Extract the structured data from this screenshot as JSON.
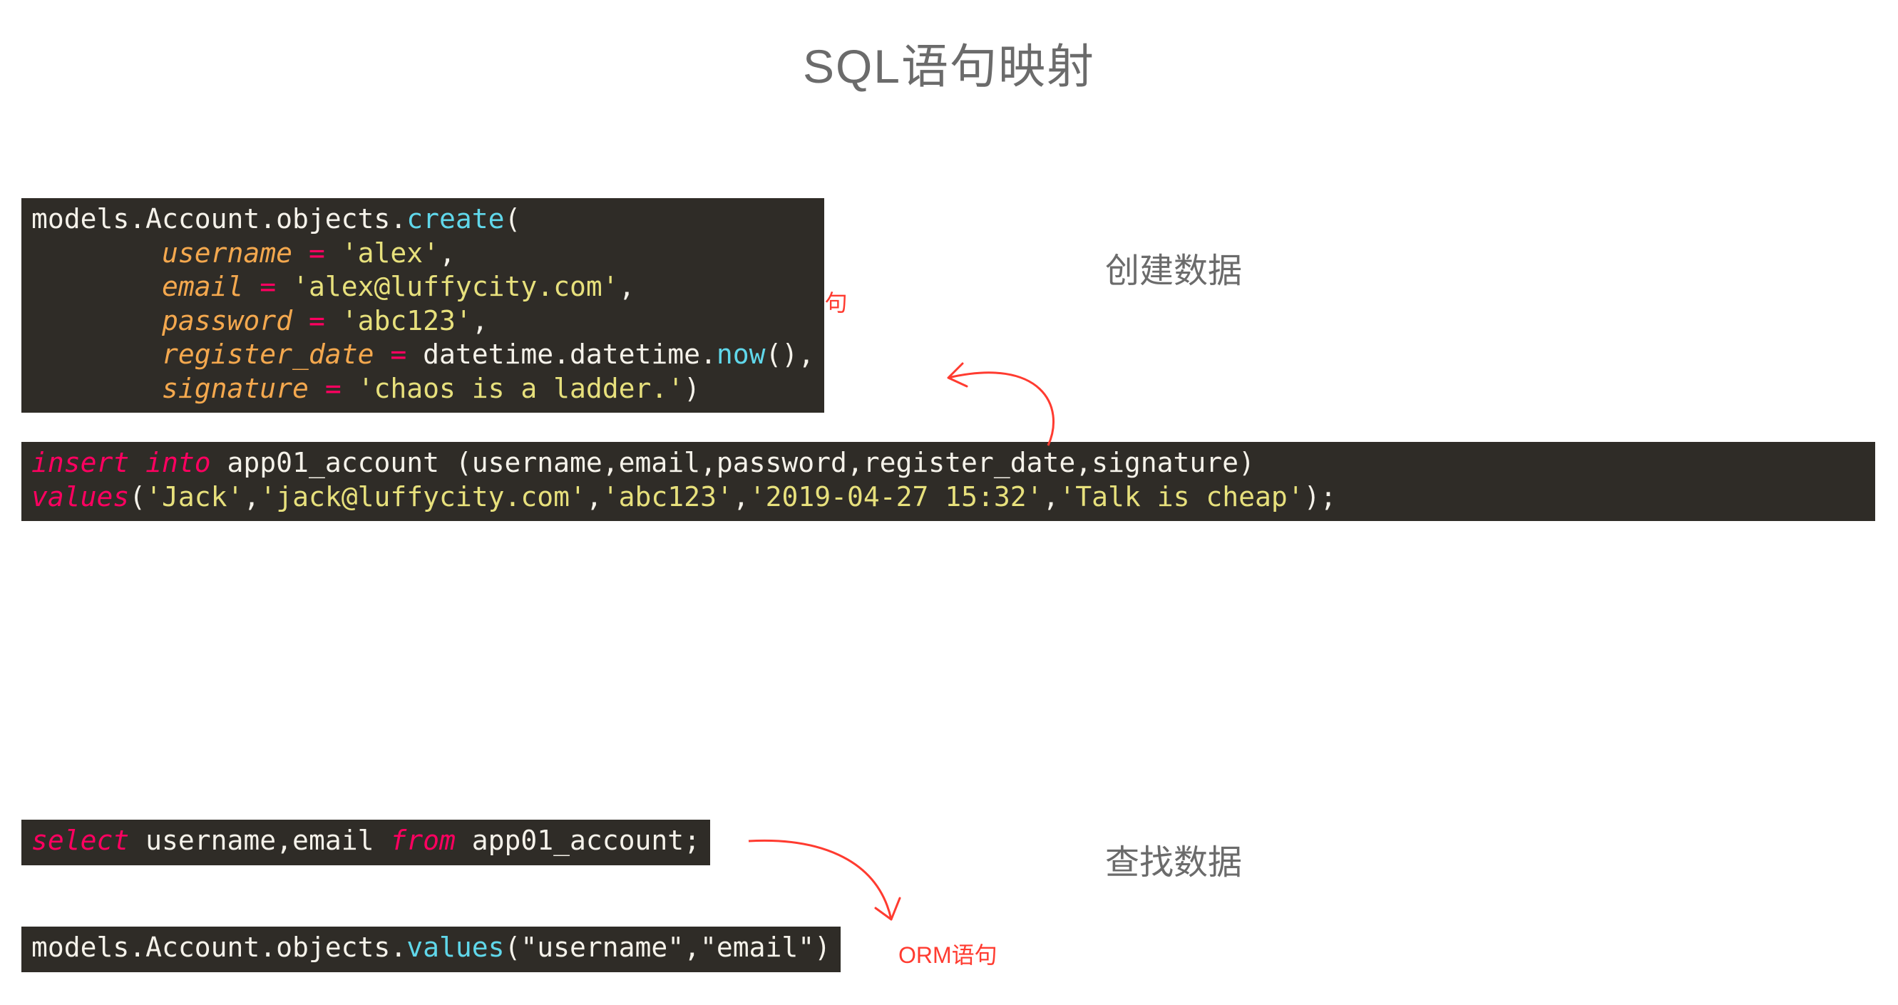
{
  "title": "SQL语句映射",
  "section1_label": "创建数据",
  "section2_label": "查找数据",
  "orm_label_1": "ORM语句",
  "orm_label_2": "ORM语句",
  "code": {
    "orm_create": {
      "prefix": "models.Account.objects.",
      "method": "create",
      "open": "(",
      "lines": [
        {
          "indent": "        ",
          "key": "username",
          "eq": " = ",
          "val": "'alex'",
          "trail": ","
        },
        {
          "indent": "        ",
          "key": "email",
          "eq": " = ",
          "val": "'alex@luffycity.com'",
          "trail": ","
        },
        {
          "indent": "        ",
          "key": "password",
          "eq": " = ",
          "val": "'abc123'",
          "trail": ","
        },
        {
          "indent": "        ",
          "key": "register_date",
          "eq": " = ",
          "expr_pre": "datetime.datetime.",
          "expr_method": "now",
          "expr_post": "()",
          "trail": ","
        },
        {
          "indent": "        ",
          "key": "signature",
          "eq": " = ",
          "val": "'chaos is a ladder.'",
          "trail": ")"
        }
      ]
    },
    "sql_insert": {
      "kw1": "insert into",
      "mid1": " app01_account (username,email,password,register_date,signature)",
      "kw2": "values",
      "open": "(",
      "v1": "'Jack'",
      "c1": ",",
      "v2": "'jack@luffycity.com'",
      "c2": ",",
      "v3": "'abc123'",
      "c3": ",",
      "v4": "'2019-04-27 15:32'",
      "c4": ",",
      "v5": "'Talk is cheap'",
      "close": ");"
    },
    "sql_select": {
      "kw1": "select",
      "mid1": " username,email ",
      "kw2": "from",
      "mid2": " app01_account;"
    },
    "orm_values": {
      "prefix": "models.Account.objects.",
      "method": "values",
      "args": "(\"username\",\"email\")"
    }
  }
}
